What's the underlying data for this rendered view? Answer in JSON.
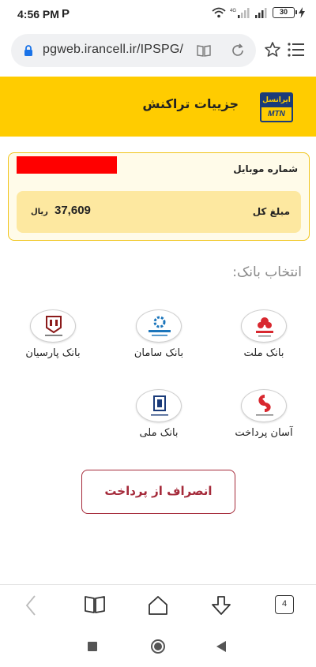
{
  "status": {
    "time": "4:56 PM",
    "carrier_icon": "P",
    "battery": "30"
  },
  "browser": {
    "url": "pgweb.irancell.ir/IPSPG/",
    "tabs_count": "4"
  },
  "header": {
    "title": "جزییات تراکنش",
    "logo_top": "ایرانسل",
    "logo_bottom": "MTN"
  },
  "transaction": {
    "mobile_label": "شماره موبایل",
    "amount_label": "مبلغ کل",
    "amount_value": "37,609",
    "amount_unit": "ریال"
  },
  "banks": {
    "heading": "انتخاب بانک:",
    "items": [
      {
        "name": "بانک ملت",
        "icon": "bank-mellat-logo"
      },
      {
        "name": "بانک سامان",
        "icon": "bank-saman-logo"
      },
      {
        "name": "بانک پارسیان",
        "icon": "bank-parsian-logo"
      },
      {
        "name": "آسان پرداخت",
        "icon": "asan-pardakht-logo"
      },
      {
        "name": "بانک ملی",
        "icon": "bank-melli-logo"
      }
    ]
  },
  "cancel_label": "انصراف از پرداخت",
  "colors": {
    "header": "#ffcc00",
    "accent_red": "#a52a3a",
    "card_border": "#f0c419"
  }
}
